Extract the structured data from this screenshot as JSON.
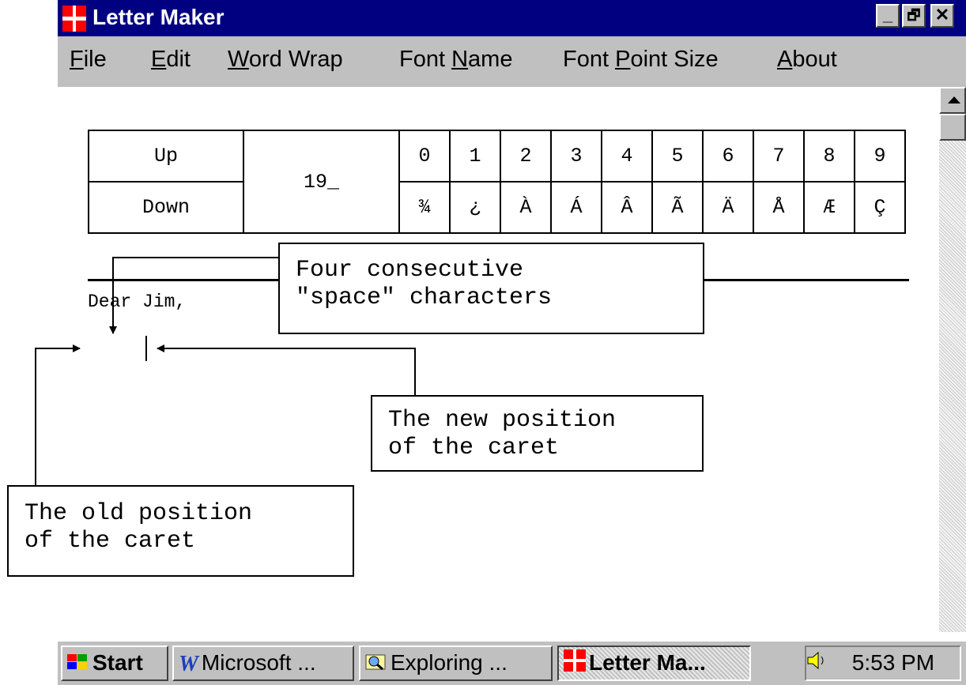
{
  "window": {
    "title": "Letter Maker",
    "controls": {
      "minimize": "_",
      "restore": "🗗",
      "close": "✕"
    }
  },
  "menu": {
    "items": [
      {
        "label": "File",
        "accel": "F",
        "rest": "ile"
      },
      {
        "label": "Edit",
        "accel": "E",
        "rest": "dit"
      },
      {
        "label": "Word Wrap",
        "accel": "W",
        "rest": "ord Wrap"
      },
      {
        "label": "Font Name",
        "pre": "Font ",
        "accel": "N",
        "rest": "ame"
      },
      {
        "label": "Font Point Size",
        "pre": "Font ",
        "accel": "P",
        "rest": "oint Size"
      },
      {
        "label": "About",
        "accel": "A",
        "rest": "bout"
      }
    ]
  },
  "char_table": {
    "up_label": "Up",
    "down_label": "Down",
    "number": "19_",
    "digits": [
      "0",
      "1",
      "2",
      "3",
      "4",
      "5",
      "6",
      "7",
      "8",
      "9"
    ],
    "chars": [
      "¾",
      "¿",
      "À",
      "Á",
      "Â",
      "Ã",
      "Ä",
      "Å",
      "Æ",
      "Ç"
    ]
  },
  "document": {
    "greeting": "Dear Jim,"
  },
  "callouts": {
    "space_chars": "Four consecutive\n\"space\" characters",
    "new_caret": "The new position\nof the caret",
    "old_caret": "The old position\nof the caret"
  },
  "taskbar": {
    "start": "Start",
    "buttons": [
      "Microsoft ...",
      "Exploring ...",
      "Letter Ma..."
    ],
    "clock": "5:53 PM"
  },
  "colors": {
    "titlebar": "#000080",
    "chrome": "#c0c0c0",
    "icon_red": "#ff0000"
  }
}
